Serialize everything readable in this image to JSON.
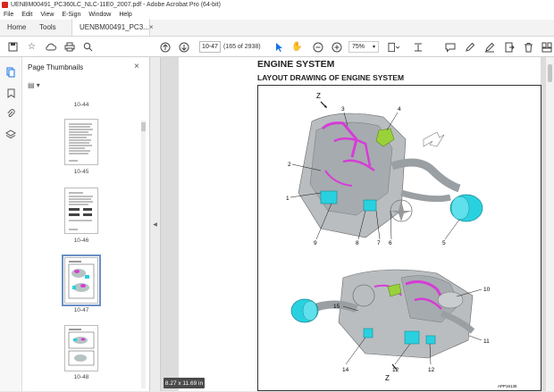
{
  "window": {
    "title": "UENBM00491_PC360LC_NLC-11E0_2007.pdf - Adobe Acrobat Pro (64-bit)"
  },
  "menu": [
    "File",
    "Edit",
    "View",
    "E-Sign",
    "Window",
    "Help"
  ],
  "tabs": {
    "home": "Home",
    "tools": "Tools",
    "document": "UENBM00491_PC3...",
    "document_close": "×"
  },
  "toolbar": {
    "page_number": "10-47",
    "page_count": "(165 of 2938)",
    "zoom": "75%"
  },
  "thumbnails_panel": {
    "title": "Page Thumbnails",
    "close": "×",
    "options": "▤ ▾",
    "labels": [
      "10-44",
      "10-45",
      "10-46",
      "10-47",
      "10-48"
    ],
    "selected": "10-47"
  },
  "document": {
    "heading": "ENGINE SYSTEM",
    "subheading": "LAYOUT DRAWING OF ENGINE SYSTEM",
    "callouts_top": [
      "Z",
      "3",
      "4",
      "2",
      "1",
      "9",
      "8",
      "7",
      "6",
      "5"
    ],
    "callouts_bottom": [
      "10",
      "15",
      "11",
      "14",
      "12",
      "Z",
      "12"
    ],
    "figure_code": "APP16135",
    "page_size": "8.27 x 11.69 in"
  },
  "colors": {
    "accent_blue": "#1473e6",
    "highlight_magenta": "#d63cd6",
    "highlight_cyan": "#29d1e0",
    "highlight_green": "#9ad13a"
  }
}
